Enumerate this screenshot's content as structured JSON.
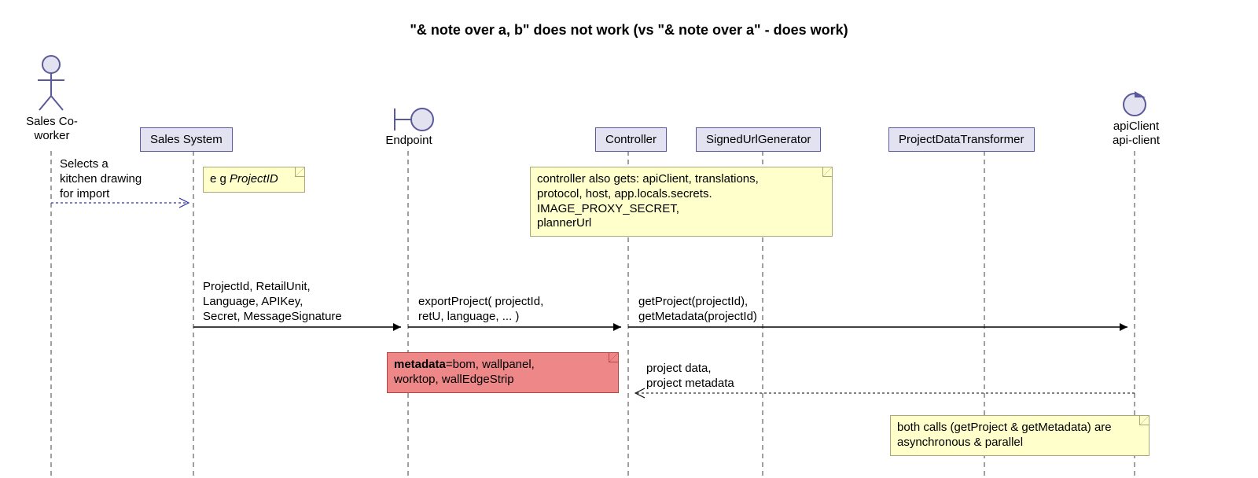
{
  "title": "\"& note over a, b\" does not work (vs \"& note over a\" - does work)",
  "participants": {
    "actor": "Sales\nCo-worker",
    "salesSystem": "Sales System",
    "endpoint": "Endpoint",
    "controller": "Controller",
    "signedUrlGenerator": "SignedUrlGenerator",
    "projectDataTransformer": "ProjectDataTransformer",
    "apiClient": "apiClient\napi-client"
  },
  "messages": {
    "m1": "Selects a\nkitchen drawing\nfor import",
    "m2": "ProjectId, RetailUnit,\nLanguage, APIKey,\nSecret, MessageSignature",
    "m3": "exportProject( projectId,\nretU, language, ... )",
    "m4": "getProject(projectId),\ngetMetadata(projectId)",
    "m5": "project data,\nproject metadata"
  },
  "notes": {
    "n1_prefix": "e g ",
    "n1_emph": "ProjectID",
    "n2": "controller also gets: apiClient, translations,\nprotocol, host, app.locals.secrets.\n   IMAGE_PROXY_SECRET,\nplannerUrl",
    "n3_bold": "metadata",
    "n3_rest": "=bom, wallpanel,\nworktop, wallEdgeStrip",
    "n4": "both calls (getProject & getMetadata) are\nasynchronous & parallel"
  }
}
